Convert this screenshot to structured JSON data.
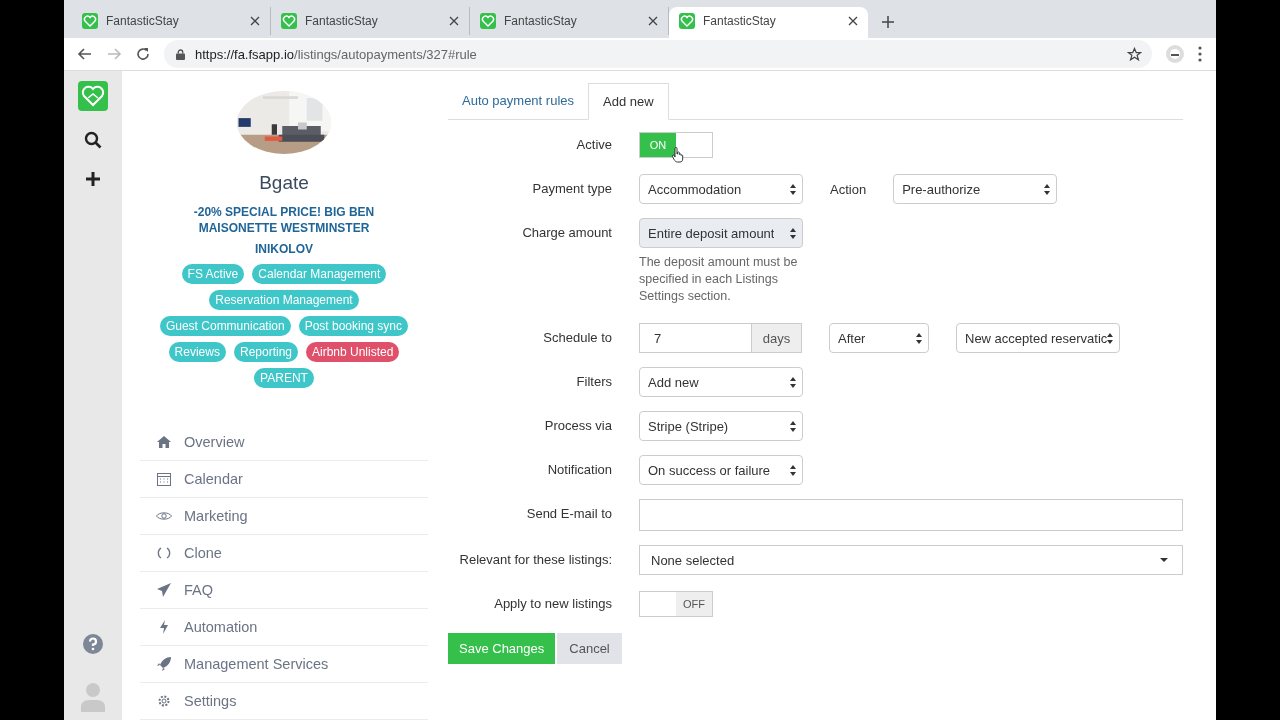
{
  "browser": {
    "tabs": [
      {
        "title": "FantasticStay",
        "selected": false
      },
      {
        "title": "FantasticStay",
        "selected": false
      },
      {
        "title": "FantasticStay",
        "selected": false
      },
      {
        "title": "FantasticStay",
        "selected": true
      }
    ],
    "url_host": "https://fa.fsapp.io",
    "url_path": "/listings/autopayments/327#rule"
  },
  "listing": {
    "name": "Bgate",
    "title": "-20% SPECIAL PRICE! BIG BEN MAISONETTE WESTMINSTER",
    "owner": "INIKOLOV",
    "tags": [
      {
        "label": "FS Active",
        "color": "#3ec6c8"
      },
      {
        "label": "Calendar Management",
        "color": "#3ec6c8"
      },
      {
        "label": "Reservation Management",
        "color": "#3ec6c8"
      },
      {
        "label": "Guest Communication",
        "color": "#3ec6c8"
      },
      {
        "label": "Post booking sync",
        "color": "#3ec6c8"
      },
      {
        "label": "Reviews",
        "color": "#3ec6c8"
      },
      {
        "label": "Reporting",
        "color": "#3ec6c8"
      },
      {
        "label": "Airbnb Unlisted",
        "color": "#e0506a"
      },
      {
        "label": "PARENT",
        "color": "#3ec6c8"
      }
    ]
  },
  "nav": [
    {
      "label": "Overview"
    },
    {
      "label": "Calendar"
    },
    {
      "label": "Marketing"
    },
    {
      "label": "Clone"
    },
    {
      "label": "FAQ"
    },
    {
      "label": "Automation"
    },
    {
      "label": "Management Services"
    },
    {
      "label": "Settings"
    }
  ],
  "form_tabs": [
    {
      "label": "Auto payment rules",
      "selected": false
    },
    {
      "label": "Add new",
      "selected": true
    }
  ],
  "rows": [
    {
      "label": "Active",
      "controls": [
        {
          "kind": "toggle",
          "on": true,
          "text": "ON"
        }
      ]
    },
    {
      "label": "Payment type",
      "controls": [
        {
          "kind": "select",
          "value": "Accommodation",
          "disabled": false
        },
        {
          "kind": "label",
          "text": "Action"
        },
        {
          "kind": "select",
          "value": "Pre-authorize",
          "disabled": false
        }
      ]
    },
    {
      "label": "Charge amount",
      "controls": [
        {
          "kind": "select",
          "value": "Entire deposit amount",
          "disabled": true
        }
      ],
      "note": "The deposit amount must be specified in each Listings Settings section."
    },
    {
      "label": "Schedule to",
      "controls": [
        {
          "kind": "number",
          "value": "7",
          "addon": "days"
        },
        {
          "kind": "select",
          "value": "After",
          "disabled": false
        },
        {
          "kind": "select",
          "value": "New accepted reservatic",
          "disabled": false
        }
      ]
    },
    {
      "label": "Filters",
      "controls": [
        {
          "kind": "select",
          "value": "Add new",
          "disabled": false
        }
      ]
    },
    {
      "label": "Process via",
      "controls": [
        {
          "kind": "select",
          "value": "Stripe (Stripe)",
          "disabled": false
        }
      ]
    },
    {
      "label": "Notification",
      "controls": [
        {
          "kind": "select",
          "value": "On success or failure",
          "disabled": false
        }
      ]
    },
    {
      "label": "Send E-mail to",
      "controls": [
        {
          "kind": "email"
        }
      ]
    },
    {
      "label": "Relevant for these listings:",
      "controls": [
        {
          "kind": "multiselect",
          "value": "None selected"
        }
      ]
    },
    {
      "label": "Apply to new listings",
      "controls": [
        {
          "kind": "toggle",
          "on": false,
          "text": "OFF"
        }
      ]
    }
  ],
  "buttons": [
    {
      "label": "Save Changes",
      "kind": "primary"
    },
    {
      "label": "Cancel",
      "kind": "secondary"
    }
  ]
}
